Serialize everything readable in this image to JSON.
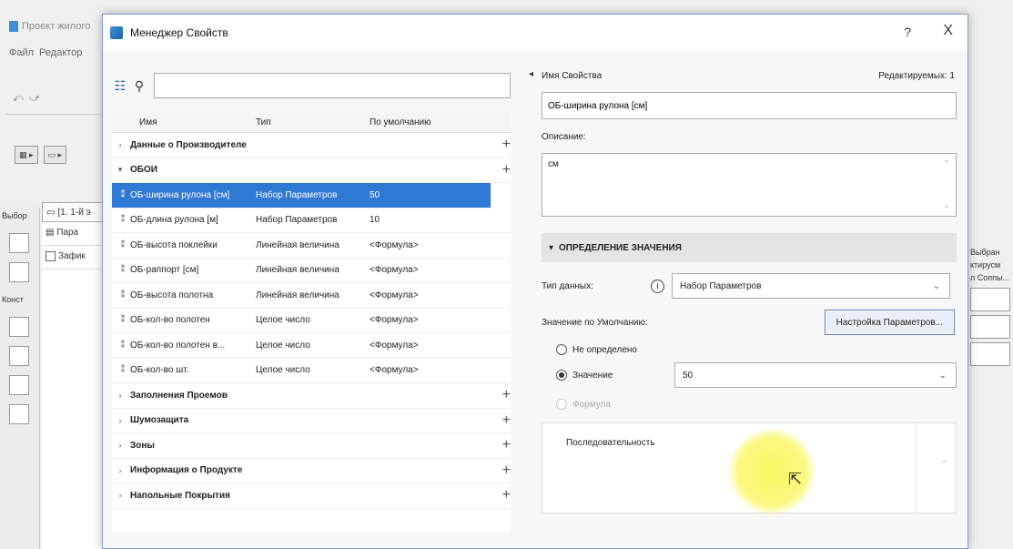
{
  "background": {
    "window_title": "Проект жилого",
    "menu": [
      "Файл",
      "Редактор"
    ],
    "toolbar_items": [
      "⤺",
      "⤻"
    ],
    "side_label_select": "Выбор",
    "side_label_construct": "Конст",
    "tab_label": "[1. 1-й э",
    "panel_rows": [
      "Пара",
      "Зафик"
    ],
    "right_labels": [
      "Выбран",
      "ктирусм",
      "л Соппы..."
    ]
  },
  "dialog": {
    "title": "Менеджер Свойств",
    "help": "?",
    "close": "X"
  },
  "left": {
    "search_placeholder": "",
    "columns": {
      "name": "Имя",
      "type": "Тип",
      "default": "По умолчанию"
    },
    "rows": [
      {
        "kind": "group",
        "expanded": false,
        "name": "Данные о Производителе"
      },
      {
        "kind": "group",
        "expanded": true,
        "name": "ОБОИ"
      },
      {
        "kind": "item",
        "name": "ОБ-ширина рулона [см]",
        "type": "Набор Параметров",
        "default": "50",
        "selected": true
      },
      {
        "kind": "item",
        "name": "ОБ-длина рулона [м]",
        "type": "Набор Параметров",
        "default": "10"
      },
      {
        "kind": "item",
        "name": "ОБ-высота поклейки",
        "type": "Линейная величина",
        "default": "<Формула>"
      },
      {
        "kind": "item",
        "name": "ОБ-раппорт [см]",
        "type": "Линейная величина",
        "default": "<Формула>"
      },
      {
        "kind": "item",
        "name": "ОБ-высота полотна",
        "type": "Линейная величина",
        "default": "<Формула>"
      },
      {
        "kind": "item",
        "name": "ОБ-кол-во полотен",
        "type": "Целое число",
        "default": "<Формула>"
      },
      {
        "kind": "item",
        "name": "ОБ-кол-во полотен в...",
        "type": "Целое число",
        "default": "<Формула>"
      },
      {
        "kind": "item",
        "name": "ОБ-кол-во шт.",
        "type": "Целое число",
        "default": "<Формула>"
      },
      {
        "kind": "group",
        "expanded": false,
        "name": "Заполнения Проемов"
      },
      {
        "kind": "group",
        "expanded": false,
        "name": "Шумозащита"
      },
      {
        "kind": "group",
        "expanded": false,
        "name": "Зоны"
      },
      {
        "kind": "group",
        "expanded": false,
        "name": "Информация о Продукте"
      },
      {
        "kind": "group",
        "expanded": false,
        "name": "Напольные Покрытия"
      }
    ]
  },
  "right": {
    "name_label": "Имя Свойства",
    "editable_label": "Редактируемых: 1",
    "name_value": "ОБ-ширина рулона [см]",
    "description_label": "Описание:",
    "description_value": "см",
    "section_title": "ОПРЕДЕЛЕНИЕ ЗНАЧЕНИЯ",
    "data_type_label": "Тип данных:",
    "data_type_value": "Набор Параметров",
    "default_label": "Значение по Умолчанию:",
    "params_button": "Настройка Параметров...",
    "radio_undefined": "Не определено",
    "radio_value": "Значение",
    "radio_formula": "Формула",
    "value_selected": "50",
    "sequence_header": "Последовательность"
  }
}
